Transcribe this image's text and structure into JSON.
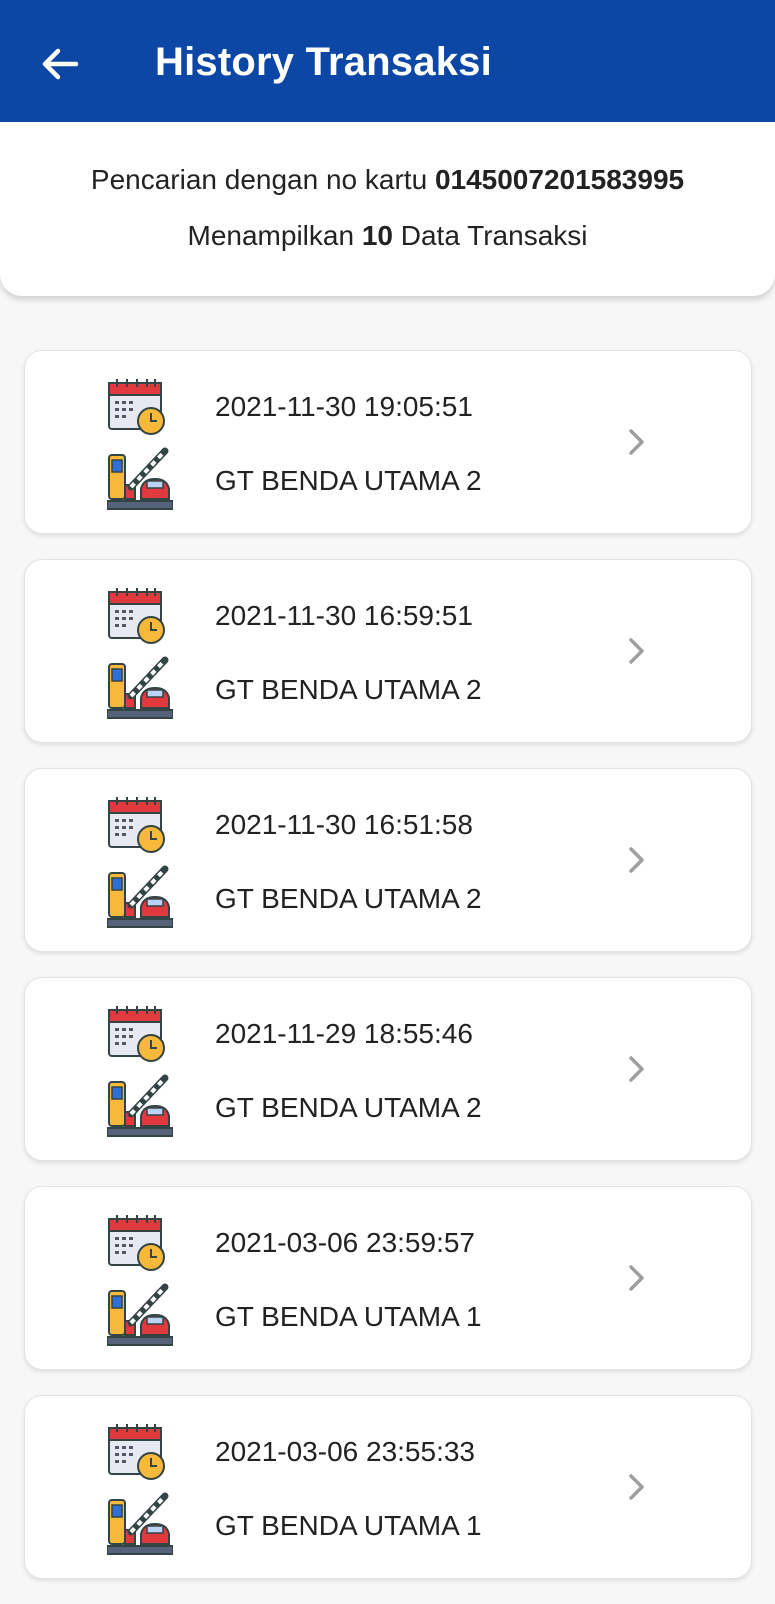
{
  "header": {
    "title": "History Transaksi",
    "back_icon": "arrow-left-icon"
  },
  "info": {
    "search_prefix": "Pencarian dengan no kartu ",
    "card_number": "0145007201583995",
    "showing_prefix": "Menampilkan ",
    "count": "10",
    "showing_suffix": " Data Transaksi"
  },
  "transactions": [
    {
      "datetime": "2021-11-30 19:05:51",
      "location": "GT BENDA UTAMA 2"
    },
    {
      "datetime": "2021-11-30 16:59:51",
      "location": "GT BENDA UTAMA 2"
    },
    {
      "datetime": "2021-11-30 16:51:58",
      "location": "GT BENDA UTAMA 2"
    },
    {
      "datetime": "2021-11-29 18:55:46",
      "location": "GT BENDA UTAMA 2"
    },
    {
      "datetime": "2021-03-06 23:59:57",
      "location": "GT BENDA UTAMA 1"
    },
    {
      "datetime": "2021-03-06 23:55:33",
      "location": "GT BENDA UTAMA 1"
    }
  ],
  "colors": {
    "appbar": "#0c47a6",
    "background": "#f7f7f7"
  }
}
